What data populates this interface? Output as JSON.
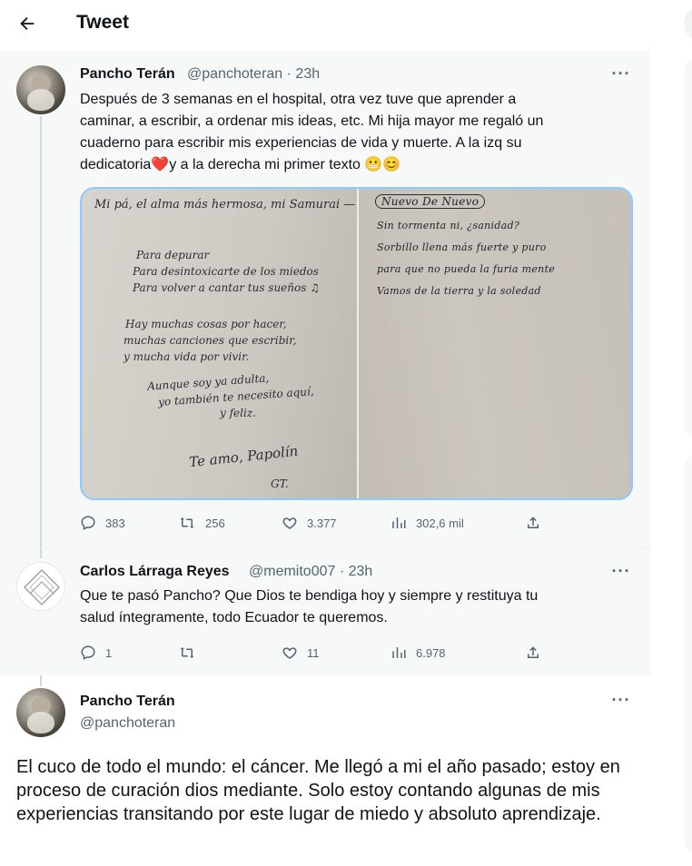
{
  "header": {
    "title": "Tweet"
  },
  "tweet1": {
    "name": "Pancho Terán",
    "handle_time": "@panchoteran · 23h",
    "text_lines": [
      "Después de 3 semanas en el hospital, otra vez tuve que aprender a",
      "caminar, a escribir, a ordenar mis ideas, etc. Mi hija mayor me regaló un",
      "cuaderno para escribir mis experiencias de vida y muerte. A la izq su",
      "dedicatoria",
      "y a la derecha mi primer texto"
    ],
    "emoji_heart": "❤️",
    "emoji_faces": "😬😊",
    "image_left": {
      "header": "Mi pá, el alma más hermosa, mi Samurai —",
      "lines": [
        "Para depurar",
        "Para desintoxicarte de los miedos",
        "Para volver a cantar tus sueños ♫",
        "Hay muchas cosas por hacer,",
        "muchas canciones que escribir,",
        "y mucha vida por vivir.",
        "Aunque soy ya adulta,",
        "yo también te necesito aquí,",
        "y feliz.",
        "Te amo, Papolín",
        "GT."
      ]
    },
    "image_right": {
      "title": "Nuevo De Nuevo",
      "lines": [
        "Sin tormenta ni, ¿sanidad?",
        "Sorbillo llena más fuerte y puro",
        "para que no pueda la furia mente",
        "Vamos de la tierra y la soledad"
      ]
    },
    "stats": {
      "replies": "383",
      "retweets": "256",
      "likes": "3.377",
      "views": "302,6 mil"
    }
  },
  "tweet2": {
    "name": "Carlos Lárraga Reyes",
    "handle_time": "@memito007 · 23h",
    "text_lines": [
      "Que te pasó Pancho? Que Dios te bendiga hoy y siempre y restituya tu",
      "salud íntegramente, todo Ecuador te queremos."
    ],
    "stats": {
      "replies": "1",
      "retweets": "",
      "likes": "11",
      "views": "6.978"
    }
  },
  "tweet3": {
    "name": "Pancho Terán",
    "handle": "@panchoteran",
    "text": "El cuco de todo el mundo: el cáncer. Me llegó a mi el año pasado; estoy en proceso de curación dios mediante. Solo estoy contando algunas de mis experiencias transitando por este lugar de miedo y absoluto aprendizaje."
  },
  "icons": {
    "back": "arrow-left-icon",
    "more": "more-dots-icon",
    "reply": "reply-icon",
    "retweet": "retweet-icon",
    "like": "heart-icon",
    "views": "views-icon",
    "share": "share-icon"
  },
  "colors": {
    "text": "#0f1419",
    "secondary": "#536471",
    "highlight_bg": "#f7f9f9",
    "media_border": "#8ec9ff",
    "heart": "#e0245e"
  }
}
